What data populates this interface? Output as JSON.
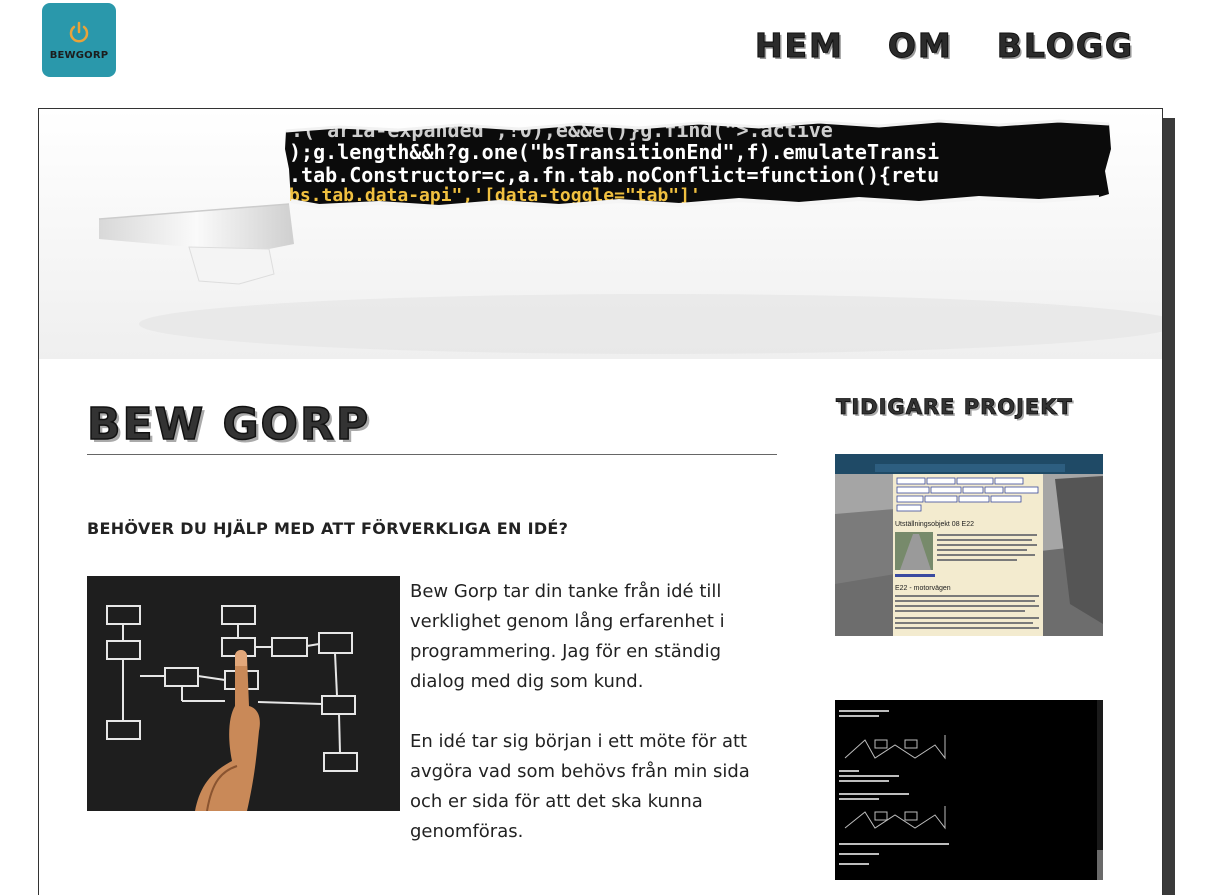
{
  "logo": {
    "text": "BEWGORP",
    "icon": "power-icon",
    "bg_color": "#2a98ab",
    "icon_color": "#e8a33a"
  },
  "nav": {
    "items": [
      "HEM",
      "OM",
      "BLOGG"
    ]
  },
  "hero": {
    "code_lines": [
      ");g.length&&h?g.one(\"bsTransitionEnd\",f).emulateTransi",
      ".tab.Constructor=c,a.fn.tab.noConflict=function(){retu",
      "bs.tab.data-api\",'[data-toggle=\"tab\"]'"
    ]
  },
  "main": {
    "title": "BEW GORP",
    "subheading": "BEHÖVER DU HJÄLP MED ATT FÖRVERKLIGA EN IDÉ?",
    "paragraphs": [
      "Bew Gorp tar din tanke från idé till verklighet genom lång erfarenhet i programmering. Jag för en ständig dialog med dig som kund.",
      "En idé tar sig början i ett möte för att avgöra vad som behövs från min sida och er sida för att det ska kunna genomföras."
    ]
  },
  "sidebar": {
    "title": "TIDIGARE PROJEKT",
    "project1": {
      "heading": "Utställningsobjekt 08 E22",
      "subheading": "E22 - motorvägen"
    }
  }
}
